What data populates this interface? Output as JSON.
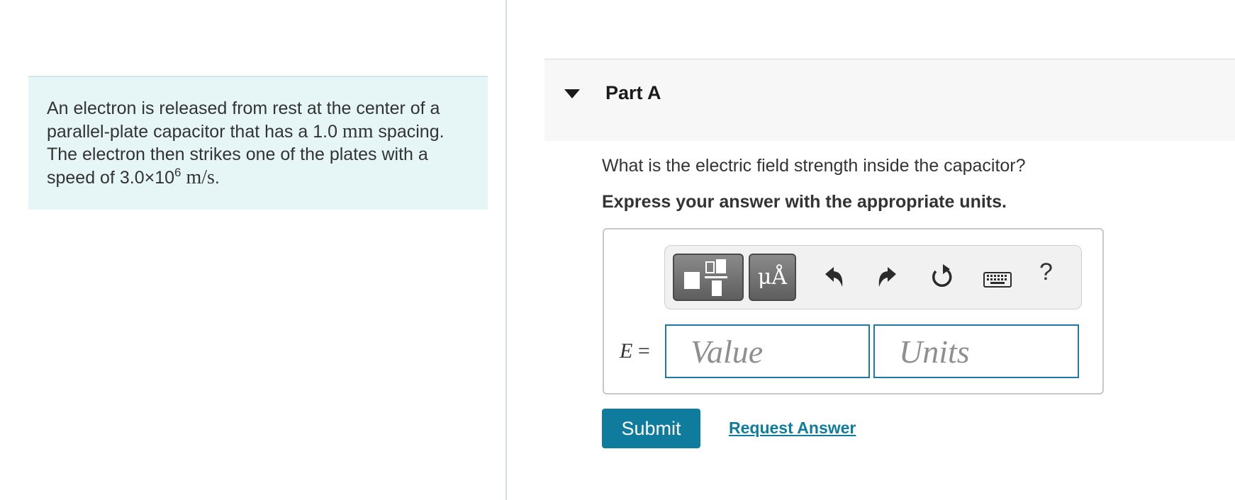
{
  "problem": {
    "line1": "An electron is released from rest at the center of a",
    "line2_pre": "parallel-plate capacitor that has a 1.0 ",
    "line2_unit": "mm",
    "line2_post": " spacing.",
    "line3": "The electron then strikes one of the plates with a",
    "line4_pre": "speed of 3.0×10",
    "line4_exp": "6",
    "line4_unit": "m/s",
    "line4_post": "."
  },
  "part": {
    "title": "Part A",
    "question": "What is the electric field strength inside the capacitor?",
    "instruction": "Express your answer with the appropriate units."
  },
  "answer": {
    "variable": "E",
    "equals": "=",
    "value_placeholder": "Value",
    "units_placeholder": "Units"
  },
  "toolbar": {
    "units_label": "μÅ",
    "help_label": "?",
    "icons": [
      "templates-icon",
      "units-icon",
      "undo-icon",
      "redo-icon",
      "reset-icon",
      "keyboard-icon",
      "help-icon"
    ]
  },
  "actions": {
    "submit_label": "Submit",
    "request_label": "Request Answer"
  },
  "colors": {
    "problem_bg": "#e6f6f6",
    "accent": "#0f7b9d",
    "field_border": "#1e7aa0"
  }
}
